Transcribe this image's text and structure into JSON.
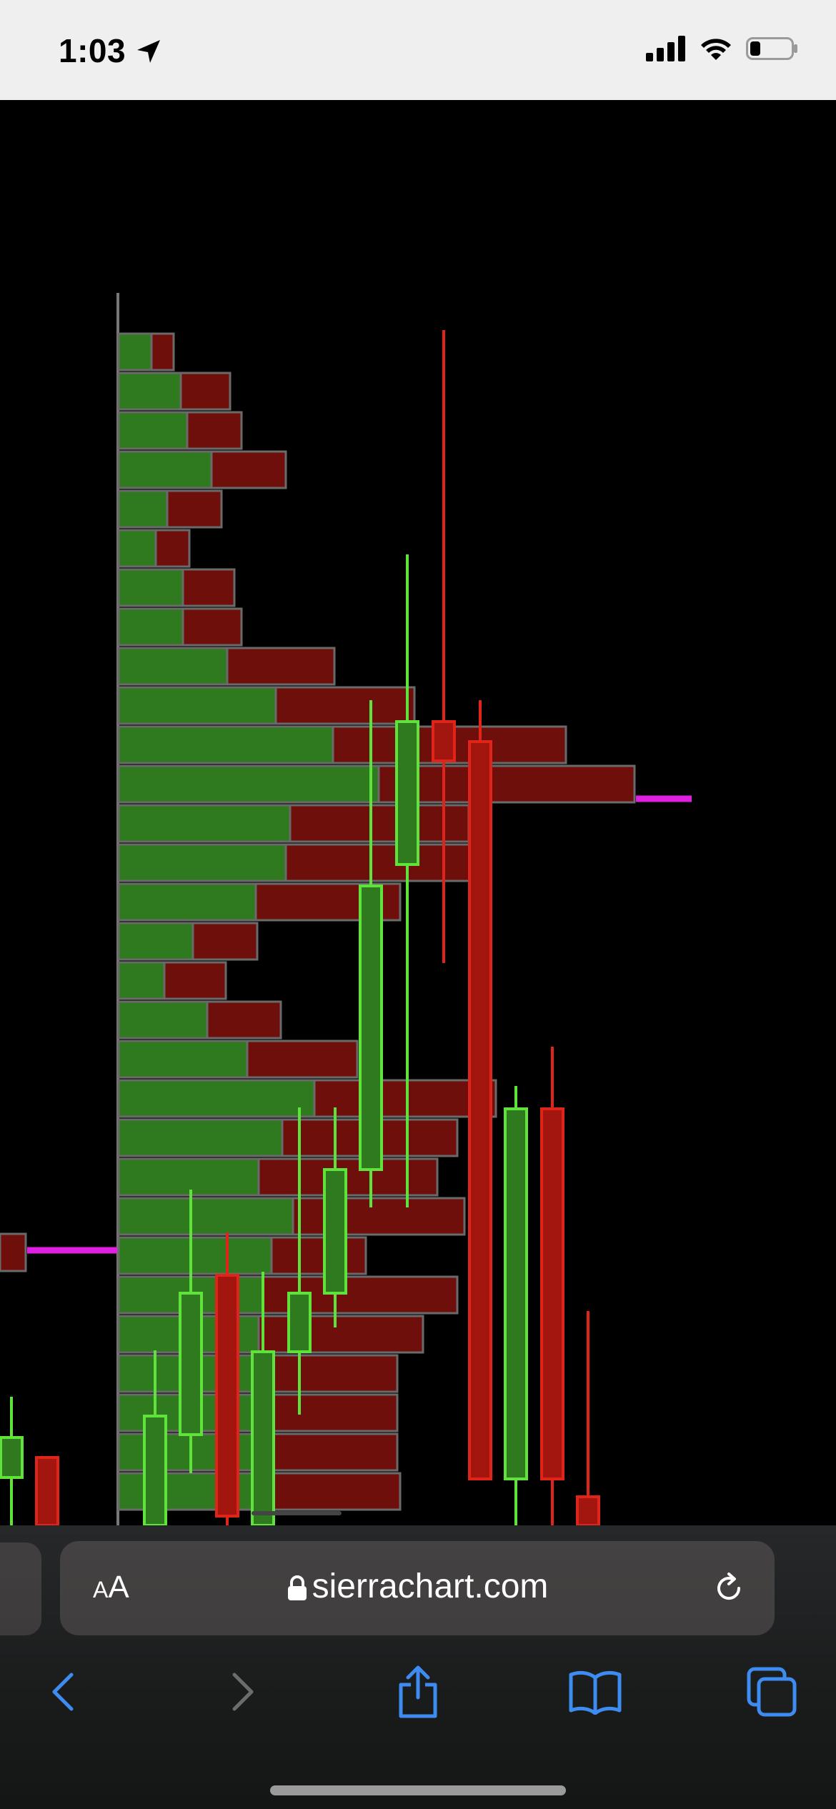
{
  "status_bar": {
    "time": "1:03",
    "location_icon": "location-arrow-icon",
    "signal_icon": "cellular-signal-icon",
    "wifi_icon": "wifi-icon",
    "battery_icon": "battery-low-icon"
  },
  "chart_data": {
    "type": "candlestick",
    "title": "",
    "colors": {
      "up": "#5fe23a",
      "down": "#e0241a",
      "profile_up": "#2f7a1f",
      "profile_down": "#6e0f0c",
      "marker": "#e020e0"
    },
    "volume_profile_rows": 30,
    "candles_visible": 15
  },
  "browser": {
    "reader_label_small": "A",
    "reader_label_large": "A",
    "domain": "sierrachart.com",
    "lock_icon": "lock-icon",
    "reload_icon": "reload-icon",
    "toolbar": [
      "back-icon",
      "forward-icon",
      "share-icon",
      "bookmarks-icon",
      "tabs-icon"
    ]
  }
}
